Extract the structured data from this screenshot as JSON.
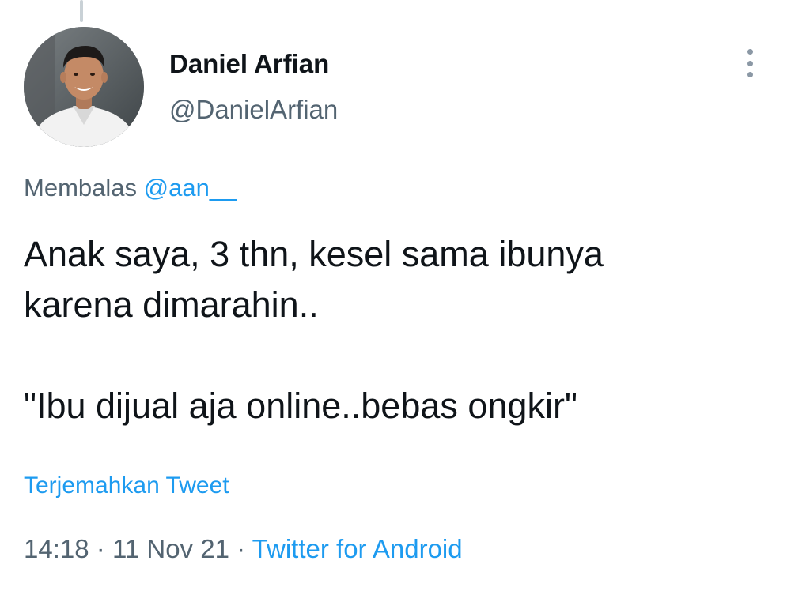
{
  "author": {
    "name": "Daniel Arfian",
    "handle": "@DanielArfian"
  },
  "reply": {
    "prefix": "Membalas",
    "to_handle": "@aan__"
  },
  "tweet": {
    "line1": "Anak saya, 3 thn, kesel sama ibunya",
    "line2": "karena dimarahin..",
    "line3": "\"Ibu dijual aja online..bebas ongkir\""
  },
  "translate_label": "Terjemahkan Tweet",
  "meta": {
    "time": "14:18",
    "separator": "·",
    "date": "11 Nov 21",
    "source": "Twitter for Android"
  },
  "icons": {
    "more": "more-vertical-icon",
    "avatar": "profile-photo"
  },
  "colors": {
    "text_primary": "#0f1419",
    "text_secondary": "#536471",
    "link": "#1d9bf0",
    "thread_line": "#c9d1d6"
  }
}
